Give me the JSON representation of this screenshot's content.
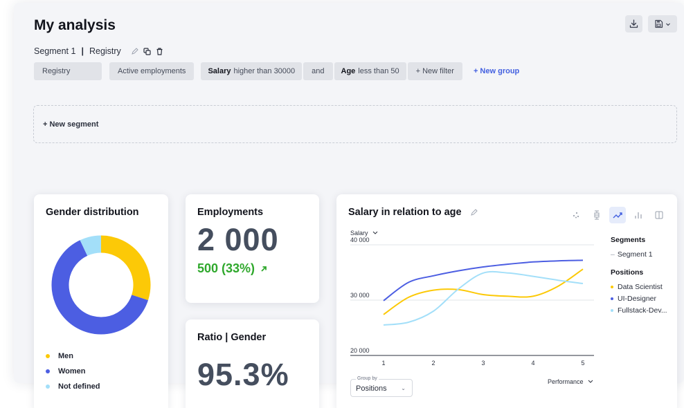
{
  "page": {
    "title": "My analysis"
  },
  "segment": {
    "name": "Segment 1",
    "separator": "|",
    "source": "Registry"
  },
  "filters": {
    "registry": "Registry",
    "active": "Active employments",
    "salary_field": "Salary",
    "salary_cond": "higher than 30000",
    "conjunction": "and",
    "age_field": "Age",
    "age_cond": "less than 50",
    "new_filter": "+ New filter",
    "new_group": "+ New group"
  },
  "new_segment": "+ New segment",
  "gender_card": {
    "title": "Gender distribution",
    "legend": [
      "Men",
      "Women",
      "Not defined"
    ],
    "chart_data": {
      "type": "pie",
      "labels": [
        "Men",
        "Women",
        "Not defined"
      ],
      "values": [
        30,
        63,
        7
      ],
      "colors": [
        "#fcc907",
        "#4c5ee2",
        "#a3dff9"
      ]
    }
  },
  "employments_card": {
    "title": "Employments",
    "value": "2 000",
    "delta": "500 (33%)"
  },
  "ratio_card": {
    "title": "Ratio | Gender",
    "value": "95.3%"
  },
  "salary_card": {
    "title": "Salary in relation to age",
    "y_dropdown": "Salary",
    "legend_segments_header": "Segments",
    "legend_segment": "Segment 1",
    "legend_positions_header": "Positions",
    "legend_positions": [
      "Data Scientist",
      "UI-Designer",
      "Fullstack-Dev..."
    ],
    "group_by_label": "Group by",
    "group_by_value": "Positions",
    "metric_dropdown": "Performance"
  },
  "chart_data": {
    "type": "line",
    "x": [
      1,
      1.5,
      2,
      2.5,
      3,
      3.5,
      4,
      4.5,
      5
    ],
    "xticks": [
      "1",
      "2",
      "3",
      "4",
      "5"
    ],
    "yticks": [
      "20 000",
      "30 000",
      "40 000"
    ],
    "ylim": [
      20000,
      40000
    ],
    "series": [
      {
        "name": "Data Scientist",
        "color": "#fcc907",
        "values": [
          27400,
          30500,
          31800,
          31900,
          31000,
          30700,
          30700,
          32500,
          35600
        ]
      },
      {
        "name": "UI-Designer",
        "color": "#4c5ee2",
        "values": [
          29900,
          33200,
          34400,
          35300,
          36000,
          36500,
          36900,
          37100,
          37200
        ]
      },
      {
        "name": "Fullstack-Dev...",
        "color": "#a3dff9",
        "values": [
          25500,
          26000,
          28000,
          32000,
          34900,
          34900,
          34300,
          33600,
          33000
        ]
      }
    ],
    "grid": true
  },
  "colors": {
    "accent": "#4360e0",
    "positive": "#2fa82c"
  }
}
